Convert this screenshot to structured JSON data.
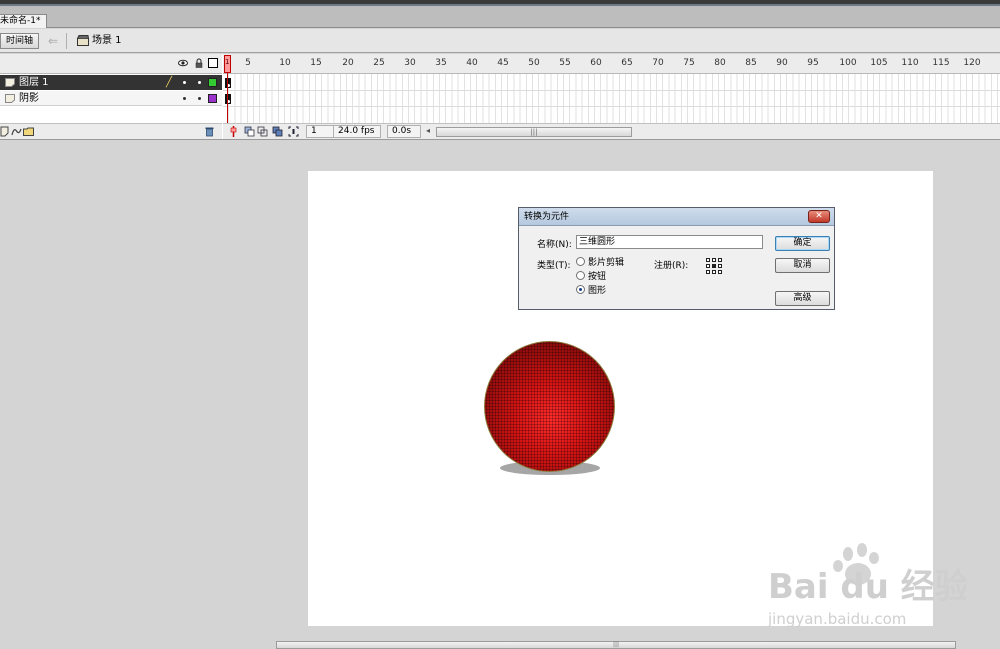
{
  "document": {
    "tab_title": "未命名-1*"
  },
  "toolbar": {
    "timeline_toggle": "时间轴",
    "scene_label": "场景 1"
  },
  "timeline": {
    "layers": [
      {
        "name": "图层 1",
        "color": "#33cc33",
        "selected": true
      },
      {
        "name": "阴影",
        "color": "#9933cc",
        "selected": false
      }
    ],
    "ruler_labels": [
      "1",
      "5",
      "10",
      "15",
      "20",
      "25",
      "30",
      "35",
      "40",
      "45",
      "50",
      "55",
      "60",
      "65",
      "70",
      "75",
      "80",
      "85",
      "90",
      "95",
      "100",
      "105",
      "110",
      "115",
      "120"
    ],
    "current_frame": "1",
    "frame_rate": "24.0 fps",
    "elapsed_time": "0.0s"
  },
  "dialog": {
    "title": "转换为元件",
    "close_label": "✕",
    "name_label": "名称(N):",
    "name_value": "三维圆形",
    "type_label": "类型(T):",
    "type_options": [
      "影片剪辑",
      "按钮",
      "图形"
    ],
    "selected_type": "图形",
    "registration_label": "注册(R):",
    "ok_label": "确定",
    "cancel_label": "取消",
    "advanced_label": "高级"
  },
  "colors": {
    "ball": "#d81414",
    "stage": "#ffffff",
    "workspace": "#d4d4d4"
  },
  "watermark": {
    "brand": "Bai du 经验",
    "url": "jingyan.baidu.com"
  }
}
